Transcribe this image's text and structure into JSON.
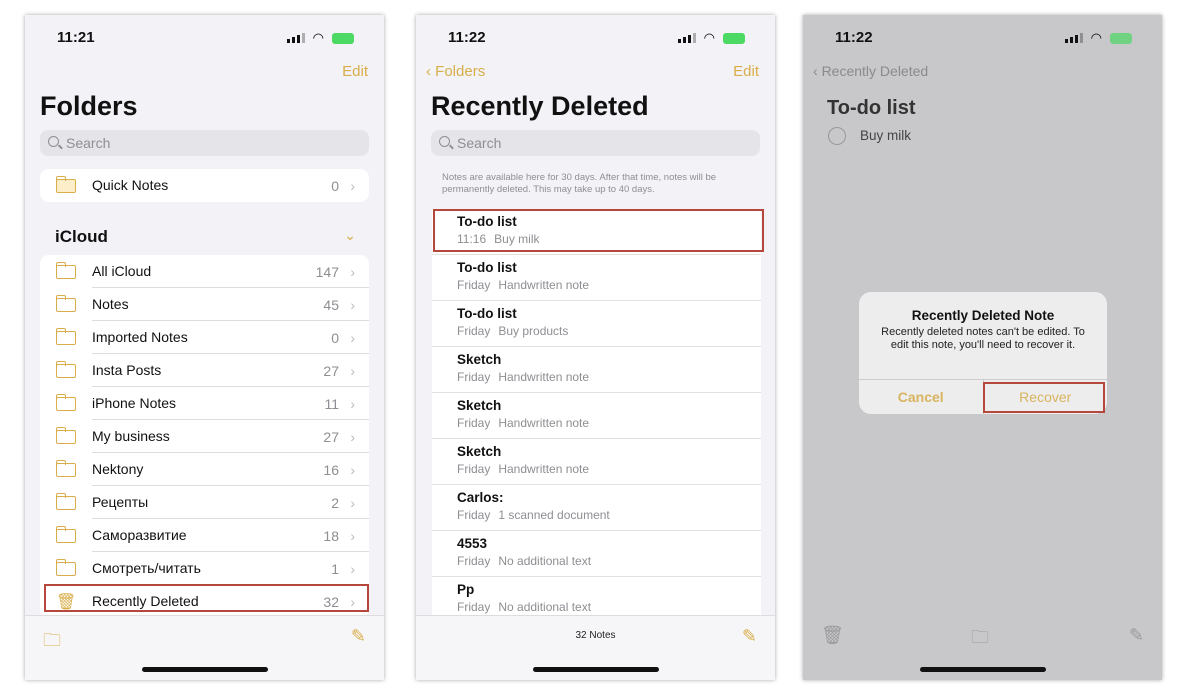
{
  "panel1": {
    "time": "11:21",
    "edit": "Edit",
    "title": "Folders",
    "search_placeholder": "Search",
    "quick_notes": {
      "label": "Quick Notes",
      "count": "0"
    },
    "section": "iCloud",
    "folders": [
      {
        "label": "All iCloud",
        "count": "147"
      },
      {
        "label": "Notes",
        "count": "45"
      },
      {
        "label": "Imported Notes",
        "count": "0"
      },
      {
        "label": "Insta Posts",
        "count": "27"
      },
      {
        "label": "iPhone Notes",
        "count": "11"
      },
      {
        "label": "My business",
        "count": "27"
      },
      {
        "label": "Nektony",
        "count": "16"
      },
      {
        "label": "Рецепты",
        "count": "2"
      },
      {
        "label": "Саморазвитие",
        "count": "18"
      },
      {
        "label": "Смотреть/читать",
        "count": "1"
      },
      {
        "label": "Recently Deleted",
        "count": "32"
      }
    ]
  },
  "panel2": {
    "time": "11:22",
    "back": "Folders",
    "edit": "Edit",
    "title": "Recently Deleted",
    "search_placeholder": "Search",
    "info": "Notes are available here for 30 days. After that time, notes will be permanently deleted. This may take up to 40 days.",
    "notes": [
      {
        "title": "To-do list",
        "date": "11:16",
        "preview": "Buy milk"
      },
      {
        "title": "To-do list",
        "date": "Friday",
        "preview": "Handwritten note"
      },
      {
        "title": "To-do list",
        "date": "Friday",
        "preview": "Buy products"
      },
      {
        "title": "Sketch",
        "date": "Friday",
        "preview": "Handwritten note"
      },
      {
        "title": "Sketch",
        "date": "Friday",
        "preview": "Handwritten note"
      },
      {
        "title": "Sketch",
        "date": "Friday",
        "preview": "Handwritten note"
      },
      {
        "title": "Carlos:",
        "date": "Friday",
        "preview": "1 scanned document"
      },
      {
        "title": "4553",
        "date": "Friday",
        "preview": "No additional text"
      },
      {
        "title": "Pp",
        "date": "Friday",
        "preview": "No additional text"
      }
    ],
    "count": "32 Notes"
  },
  "panel3": {
    "time": "11:22",
    "back": "Recently Deleted",
    "title": "To-do list",
    "item": "Buy milk",
    "dialog": {
      "title": "Recently Deleted Note",
      "message": "Recently deleted notes can't be edited. To edit this note, you'll need to recover it.",
      "cancel": "Cancel",
      "recover": "Recover"
    }
  },
  "colors": {
    "accent": "#d9ae4a",
    "highlight": "#b5473d"
  }
}
